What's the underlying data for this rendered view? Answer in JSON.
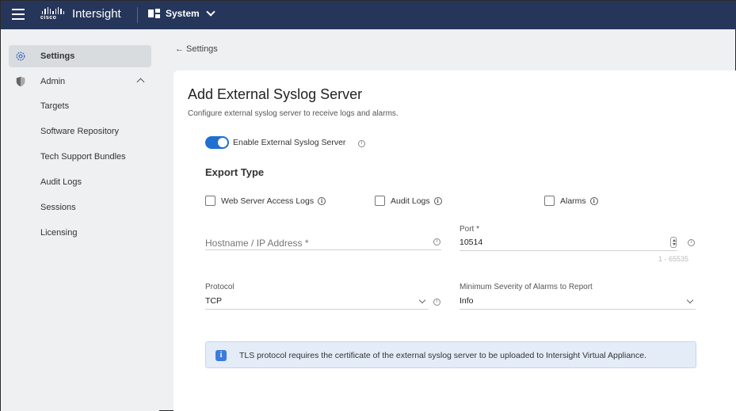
{
  "header": {
    "logo_text": "cisco",
    "app_name": "Intersight",
    "context_label": "System"
  },
  "sidebar": {
    "settings_label": "Settings",
    "admin_label": "Admin",
    "sub_items": [
      "Targets",
      "Software Repository",
      "Tech Support Bundles",
      "Audit Logs",
      "Sessions",
      "Licensing"
    ]
  },
  "breadcrumb": "← Settings",
  "form": {
    "title": "Add External Syslog Server",
    "subtitle": "Configure external syslog server to receive logs and alarms.",
    "enable_label": "Enable External Syslog Server",
    "enable_on": true,
    "export_type_title": "Export Type",
    "checkboxes": [
      {
        "label": "Web Server Access Logs",
        "checked": false
      },
      {
        "label": "Audit Logs",
        "checked": false
      },
      {
        "label": "Alarms",
        "checked": false
      }
    ],
    "hostname_placeholder": "Hostname / IP Address *",
    "port_label": "Port *",
    "port_value": "10514",
    "port_hint": "1 - 65535",
    "protocol_label": "Protocol",
    "protocol_value": "TCP",
    "severity_label": "Minimum Severity of Alarms to Report",
    "severity_value": "Info"
  },
  "banner": {
    "text": "TLS protocol requires the certificate of the external syslog server to be uploaded to Intersight Virtual Appliance."
  },
  "colors": {
    "topbar": "#26365b",
    "accent": "#1f6fd1",
    "banner_bg": "#e4ecf8"
  }
}
